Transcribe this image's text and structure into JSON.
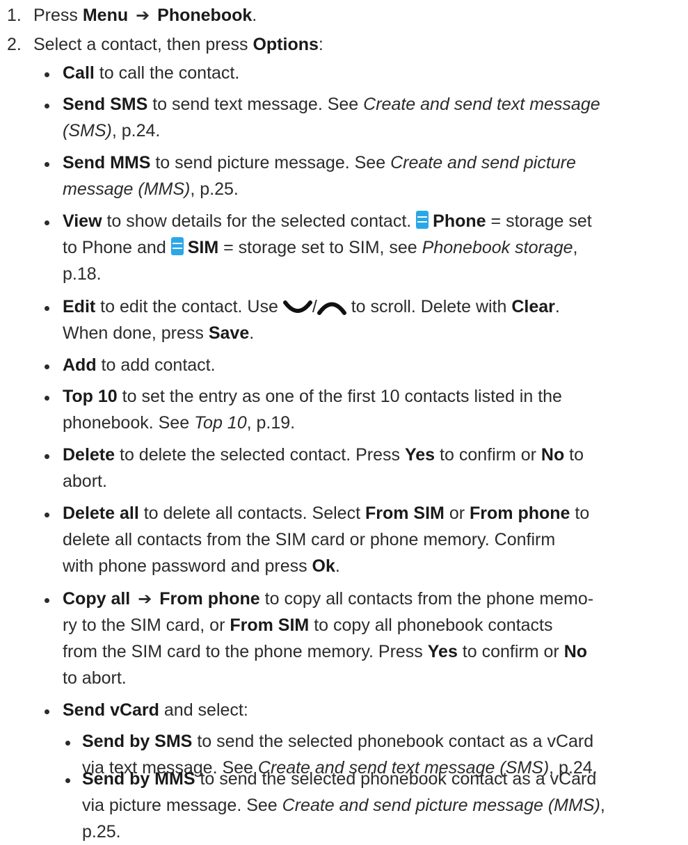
{
  "steps": [
    {
      "num": "1.",
      "pre": "Press ",
      "menu": "Menu",
      "arrow": "➔",
      "target": "Phonebook",
      "post": "."
    },
    {
      "num": "2.",
      "pre": "Select a contact, then press ",
      "options": "Options",
      "post": ":"
    }
  ],
  "options": {
    "call": {
      "label": "Call",
      "text": " to call the contact."
    },
    "send_sms": {
      "label": "Send SMS",
      "text": " to send text message. See ",
      "ref": "Create and send text message",
      "ref2": "(SMS)",
      "page": ", p.24."
    },
    "send_mms": {
      "label": "Send MMS",
      "text": " to send picture message. See ",
      "ref": "Create and send picture",
      "ref2": "message (MMS)",
      "page": ", p.25."
    },
    "view": {
      "label": "View",
      "text": " to show details for the selected contact. ",
      "phone": "Phone",
      "text2": " = storage set",
      "text3": "to Phone and ",
      "sim": "SIM",
      "text4": " = storage set to SIM, see ",
      "ref": "Phonebook storage",
      "text5": ",",
      "page": "p.18."
    },
    "edit": {
      "label": "Edit",
      "text": " to edit the contact. Use ",
      "slash": "/",
      "text2": " to scroll. Delete with ",
      "clear": "Clear",
      "dot": ".",
      "text3": "When done, press ",
      "save": "Save",
      "dot2": "."
    },
    "add": {
      "label": "Add",
      "text": " to add contact."
    },
    "top10": {
      "label": "Top 10",
      "text": " to set the entry as one of the first 10 contacts listed in the",
      "text2": "phonebook. See ",
      "ref": "Top 10",
      "page": ", p.19."
    },
    "delete": {
      "label": "Delete",
      "text": " to delete the selected contact. Press ",
      "yes": "Yes",
      "text2": " to confirm or ",
      "no": "No",
      "text3": " to",
      "text4": "abort."
    },
    "delete_all": {
      "label": "Delete all",
      "text": " to delete all contacts. Select ",
      "from_sim": "From SIM",
      "or": " or ",
      "from_phone": "From phone",
      "text2": " to",
      "text3": "delete all contacts from the SIM card or phone memory. Confirm",
      "text4": "with phone password and press ",
      "ok": "Ok",
      "dot": "."
    },
    "copy_all": {
      "label": "Copy all",
      "arrow": "➔",
      "from_phone": "From phone",
      "text": " to copy all contacts from the phone memo-",
      "text2": "ry to the SIM card, or ",
      "from_sim": "From SIM",
      "text3": " to copy all phonebook contacts",
      "text4": "from the SIM card to the phone memory. Press ",
      "yes": "Yes",
      "text5": " to confirm or ",
      "no": "No",
      "text6": "to abort."
    },
    "send_vcard": {
      "label": "Send vCard",
      "text": " and select:"
    },
    "send_by_sms": {
      "label": "Send by SMS",
      "text": " to send the selected phonebook contact as a vCard",
      "text2": "via text message. See ",
      "ref": "Create and send text message (SMS)",
      "page": ", p.24."
    },
    "send_by_mms": {
      "label": "Send by MMS",
      "text": " to send the selected phonebook contact as a vCard",
      "text2": "via picture message. See ",
      "ref": "Create and send picture message (MMS)",
      "page": ",",
      "page2": "p.25."
    }
  },
  "icons": {
    "storage_icon": "storage-list-icon",
    "down": "nav-down-icon",
    "up": "nav-up-icon"
  },
  "colors": {
    "text": "#2b2b2b",
    "icon": "#2aa7e8"
  }
}
